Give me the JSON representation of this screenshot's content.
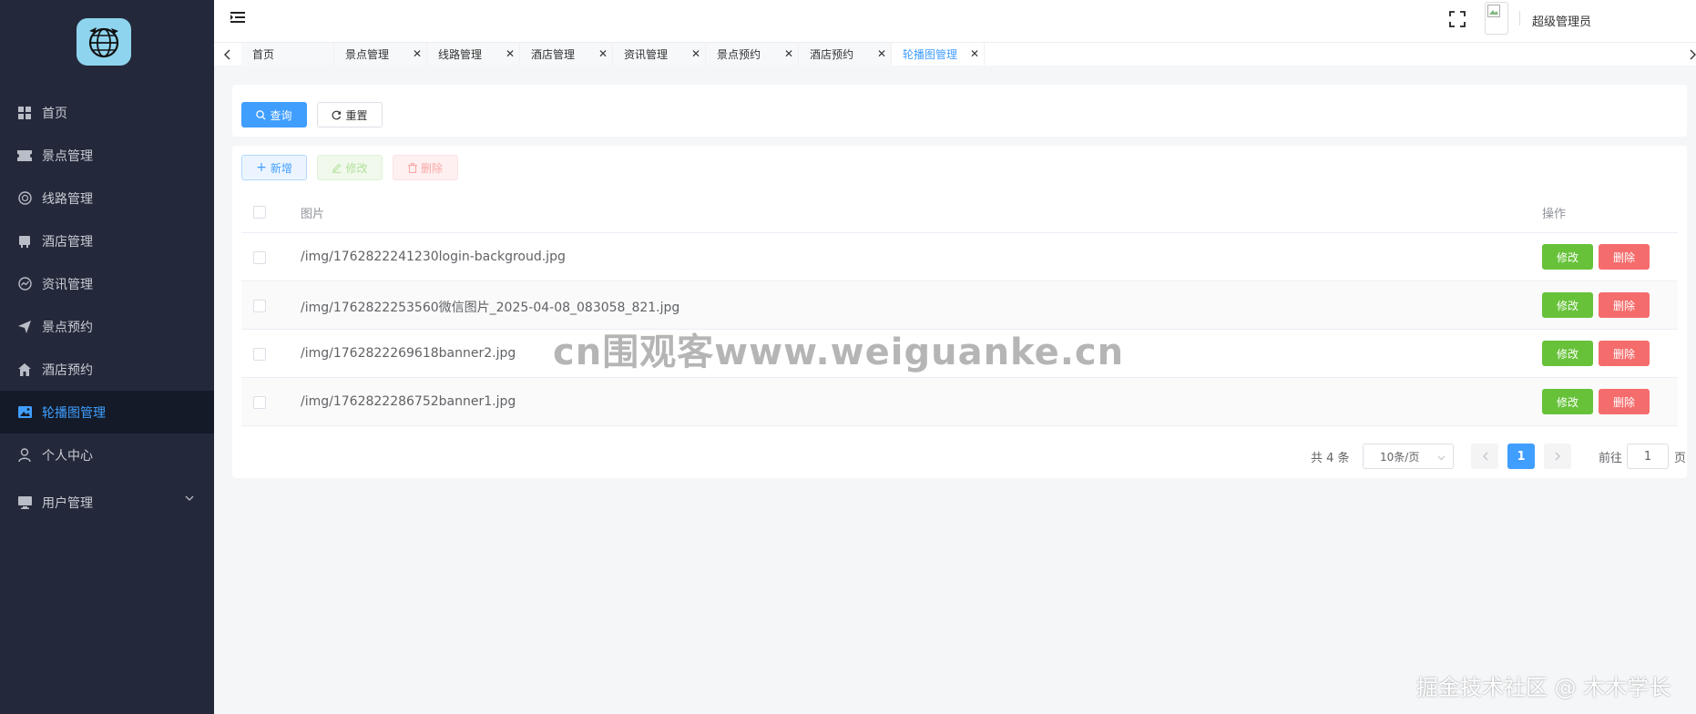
{
  "sidebar": {
    "items": [
      {
        "label": "首页",
        "icon": "dashboard-icon"
      },
      {
        "label": "景点管理",
        "icon": "ticket-icon"
      },
      {
        "label": "线路管理",
        "icon": "route-icon"
      },
      {
        "label": "酒店管理",
        "icon": "hotel-icon"
      },
      {
        "label": "资讯管理",
        "icon": "news-icon"
      },
      {
        "label": "景点预约",
        "icon": "send-icon"
      },
      {
        "label": "酒店预约",
        "icon": "home-icon"
      },
      {
        "label": "轮播图管理",
        "icon": "picture-icon"
      },
      {
        "label": "个人中心",
        "icon": "user-icon"
      },
      {
        "label": "用户管理",
        "icon": "monitor-icon"
      }
    ],
    "active_index": 7
  },
  "header": {
    "username": "超级管理员"
  },
  "tabs": [
    {
      "label": "首页",
      "closable": false
    },
    {
      "label": "景点管理",
      "closable": true
    },
    {
      "label": "线路管理",
      "closable": true
    },
    {
      "label": "酒店管理",
      "closable": true
    },
    {
      "label": "资讯管理",
      "closable": true
    },
    {
      "label": "景点预约",
      "closable": true
    },
    {
      "label": "酒店预约",
      "closable": true
    },
    {
      "label": "轮播图管理",
      "closable": true
    }
  ],
  "search": {
    "query_label": "查询",
    "reset_label": "重置"
  },
  "toolbar": {
    "add_label": "新增",
    "edit_label": "修改",
    "delete_label": "删除"
  },
  "table": {
    "columns": [
      "图片",
      "操作"
    ],
    "rows": [
      {
        "image": "/img/1762822241230login-backgroud.jpg"
      },
      {
        "image": "/img/1762822253560微信图片_2025-04-08_083058_821.jpg"
      },
      {
        "image": "/img/1762822269618banner2.jpg"
      },
      {
        "image": "/img/1762822286752banner1.jpg"
      }
    ],
    "row_edit_label": "修改",
    "row_delete_label": "删除"
  },
  "pagination": {
    "total_text": "共 4 条",
    "page_size": "10条/页",
    "current_page": "1",
    "goto_prefix": "前往",
    "goto_value": "1",
    "goto_suffix": "页"
  },
  "watermark": "cn围观客www.weiguanke.cn",
  "credit": "掘金技术社区 @ 木木学长",
  "colors": {
    "sidebar_bg": "#23293a",
    "primary": "#409eff",
    "success": "#67c23a",
    "danger": "#f56c6c"
  }
}
